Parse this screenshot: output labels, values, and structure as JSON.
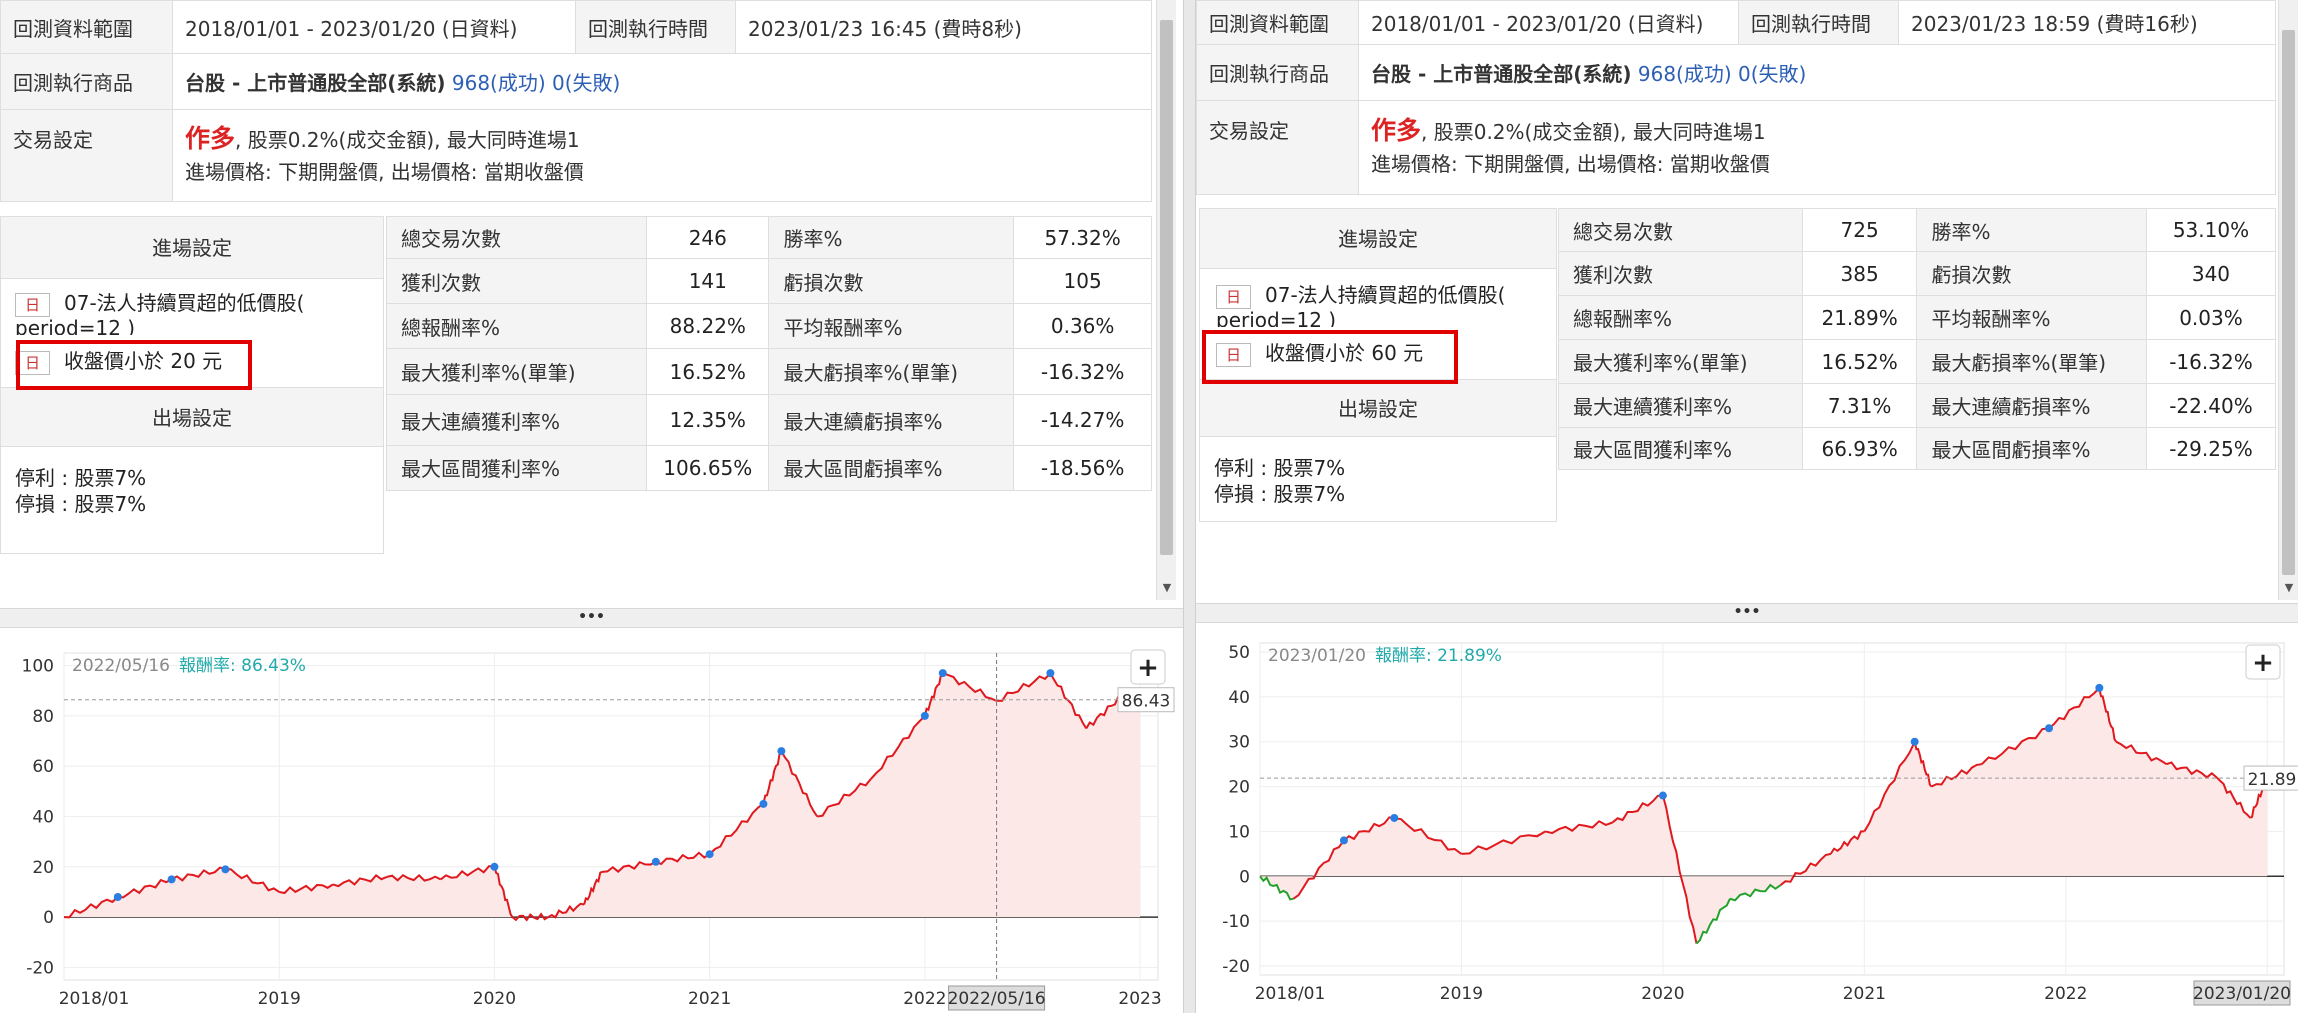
{
  "left": {
    "info": {
      "range_label": "回測資料範圍",
      "range_value": "2018/01/01 - 2023/01/20 (日資料)",
      "time_label": "回測執行時間",
      "time_value": "2023/01/23 16:45 (費時8秒)",
      "product_label": "回測執行商品",
      "product_name": "台股 - 上市普通股全部(系統)",
      "product_success": "968(成功)",
      "product_fail": "0(失敗)",
      "trade_label": "交易設定",
      "trade_direction": "作多",
      "trade_fee": ", 股票0.2%(成交金額), 最大同時進場1",
      "trade_price": "進場價格: 下期開盤價, 出場價格: 當期收盤價"
    },
    "entry": {
      "header": "進場設定",
      "day_tag": "日",
      "cond1": "07-法人持續買超的低價股(",
      "cond1b": "period=12 )",
      "cond2": "收盤價小於 20 元"
    },
    "exit": {
      "header": "出場設定",
      "take_profit": "停利 : 股票7%",
      "stop_loss": "停損 : 股票7%"
    },
    "stats": [
      {
        "l1": "總交易次數",
        "v1": "246",
        "l2": "勝率%",
        "v2": "57.32%",
        "r2": true
      },
      {
        "l1": "獲利次數",
        "v1": "141",
        "l2": "虧損次數",
        "v2": "105"
      },
      {
        "l1": "總報酬率%",
        "v1": "88.22%",
        "r1": true,
        "l2": "平均報酬率%",
        "v2": "0.36%"
      },
      {
        "l1": "最大獲利率%(單筆)",
        "v1": "16.52%",
        "l2": "最大虧損率%(單筆)",
        "v2": "-16.32%"
      },
      {
        "l1": "最大連續獲利率%",
        "v1": "12.35%",
        "l2": "最大連續虧損率%",
        "v2": "-14.27%"
      },
      {
        "l1": "最大區間獲利率%",
        "v1": "106.65%",
        "l2": "最大區間虧損率%",
        "v2": "-18.56%"
      }
    ],
    "chart_info": {
      "date": "2022/05/16",
      "ret_label": "報酬率:",
      "ret_value": "86.43%",
      "end_label": "86.43",
      "cursor_date": "2022/05/16"
    }
  },
  "right": {
    "info": {
      "range_label": "回測資料範圍",
      "range_value": "2018/01/01 - 2023/01/20 (日資料)",
      "time_label": "回測執行時間",
      "time_value": "2023/01/23 18:59 (費時16秒)",
      "product_label": "回測執行商品",
      "product_name": "台股 - 上市普通股全部(系統)",
      "product_success": "968(成功)",
      "product_fail": "0(失敗)",
      "trade_label": "交易設定",
      "trade_direction": "作多",
      "trade_fee": ", 股票0.2%(成交金額), 最大同時進場1",
      "trade_price": "進場價格: 下期開盤價, 出場價格: 當期收盤價"
    },
    "entry": {
      "header": "進場設定",
      "day_tag": "日",
      "cond1": "07-法人持續買超的低價股(",
      "cond1b": "period=12 )",
      "cond2": "收盤價小於 60 元"
    },
    "exit": {
      "header": "出場設定",
      "take_profit": "停利 : 股票7%",
      "stop_loss": "停損 : 股票7%"
    },
    "stats": [
      {
        "l1": "總交易次數",
        "v1": "725",
        "l2": "勝率%",
        "v2": "53.10%",
        "r2": true
      },
      {
        "l1": "獲利次數",
        "v1": "385",
        "l2": "虧損次數",
        "v2": "340"
      },
      {
        "l1": "總報酬率%",
        "v1": "21.89%",
        "r1": true,
        "l2": "平均報酬率%",
        "v2": "0.03%"
      },
      {
        "l1": "最大獲利率%(單筆)",
        "v1": "16.52%",
        "l2": "最大虧損率%(單筆)",
        "v2": "-16.32%"
      },
      {
        "l1": "最大連續獲利率%",
        "v1": "7.31%",
        "l2": "最大連續虧損率%",
        "v2": "-22.40%"
      },
      {
        "l1": "最大區間獲利率%",
        "v1": "66.93%",
        "l2": "最大區間虧損率%",
        "v2": "-29.25%"
      }
    ],
    "chart_info": {
      "date": "2023/01/20",
      "ret_label": "報酬率:",
      "ret_value": "21.89%",
      "end_label": "21.89",
      "cursor_date": "2023/01/20"
    }
  },
  "splitter_dots": "•••",
  "zoom_button": "+",
  "colors": {
    "profit_line": "#e0191e",
    "loss_line": "#22a22a",
    "marker": "#2a7de1",
    "fill": "#fde8e8",
    "highlight": "#e00000"
  },
  "chart_data": [
    {
      "type": "line",
      "x": [
        "2018/01",
        "2018/04",
        "2018/07",
        "2018/10",
        "2019/01",
        "2019/04",
        "2019/07",
        "2019/10",
        "2020/01",
        "2020/02",
        "2020/04",
        "2020/06",
        "2020/07",
        "2020/10",
        "2021/01",
        "2021/04",
        "2021/05",
        "2021/07",
        "2021/10",
        "2022/01",
        "2022/02",
        "2022/05",
        "2022/08",
        "2022/10",
        "2022/12",
        "2023/01"
      ],
      "series": [
        {
          "values": [
            0,
            8,
            15,
            19,
            10,
            13,
            16,
            15,
            20,
            0,
            0,
            5,
            18,
            22,
            25,
            45,
            66,
            40,
            55,
            80,
            97,
            86,
            97,
            75,
            88,
            86
          ]
        }
      ],
      "y_ticks": [
        "100",
        "80",
        "60",
        "40",
        "20",
        "0",
        "-20"
      ],
      "x_ticks": [
        "2018/01",
        "2019",
        "2020",
        "2021",
        "2022",
        "2023"
      ],
      "ylim": [
        -25,
        105
      ],
      "reference_line": 86.43
    },
    {
      "type": "line",
      "x": [
        "2018/01",
        "2018/03",
        "2018/06",
        "2018/09",
        "2019/01",
        "2019/06",
        "2019/10",
        "2020/01",
        "2020/03",
        "2020/05",
        "2020/08",
        "2020/11",
        "2021/01",
        "2021/04",
        "2021/05",
        "2021/08",
        "2021/12",
        "2022/03",
        "2022/04",
        "2022/07",
        "2022/10",
        "2022/12",
        "2023/01"
      ],
      "series": [
        {
          "values": [
            0,
            -5,
            8,
            13,
            5,
            10,
            12,
            18,
            -15,
            -5,
            -2,
            5,
            10,
            30,
            20,
            25,
            33,
            42,
            30,
            25,
            22,
            13,
            21.89
          ]
        }
      ],
      "y_ticks": [
        "50",
        "40",
        "30",
        "20",
        "10",
        "0",
        "-10",
        "-20"
      ],
      "x_ticks": [
        "2018/01",
        "2019",
        "2020",
        "2021",
        "2022",
        "2023"
      ],
      "ylim": [
        -22,
        52
      ],
      "reference_line": 21.89
    }
  ]
}
